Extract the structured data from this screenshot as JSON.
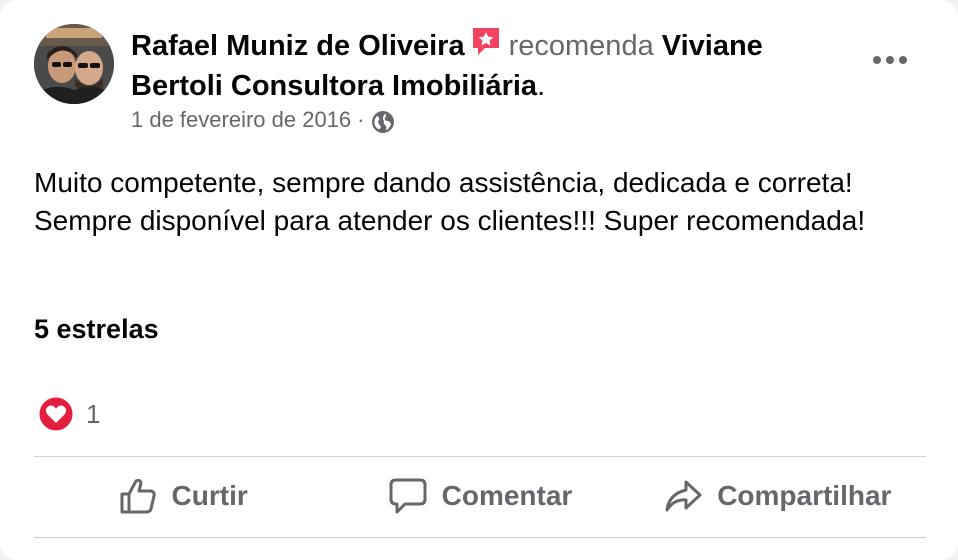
{
  "post": {
    "author": "Rafael Muniz de Oliveira",
    "verb": "recomenda",
    "target": "Viviane Bertoli Consultora Imobiliária",
    "target_suffix": ".",
    "date": "1 de fevereiro de 2016",
    "separator": "·",
    "privacy_icon": "globe-icon",
    "recommendation_icon": "recommendation-star-icon",
    "body": "Muito competente, sempre dando assistência, dedicada e correta! Sempre disponível para atender os clientes!!! Super recomendada!",
    "rating": "5 estrelas",
    "reaction_icon": "heart-reaction-icon",
    "reaction_count": "1"
  },
  "actions": {
    "like_label": "Curtir",
    "comment_label": "Comentar",
    "share_label": "Compartilhar"
  },
  "icons": {
    "more": "more-options-icon",
    "like": "thumbs-up-icon",
    "comment": "comment-bubble-icon",
    "share": "share-arrow-icon"
  },
  "colors": {
    "text_primary": "#050505",
    "text_secondary": "#65676b",
    "recommendation_red": "#f3425f",
    "heart_red": "#e41e3f",
    "divider": "#ced0d4"
  }
}
